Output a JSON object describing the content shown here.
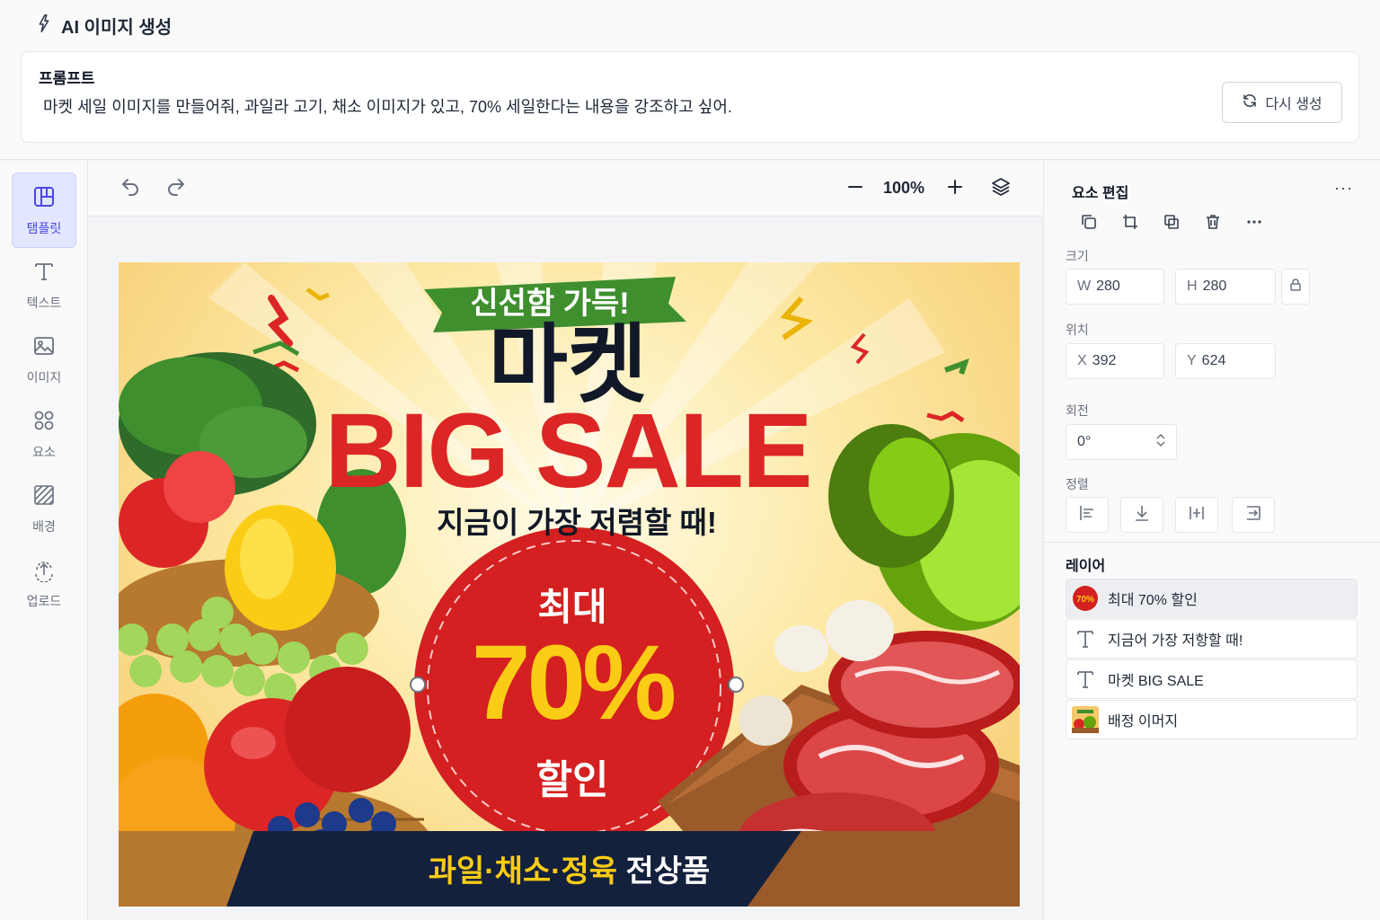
{
  "header": {
    "title": "AI 이미지 생성",
    "prompt_label": "프롬프트",
    "prompt_text": "마켓 세일 이미지를 만들어줘, 과일라 고기, 채소 이미지가 있고, 70% 세일한다는 내용을 강조하고 싶어.",
    "regenerate_label": "다시 생성"
  },
  "sidebar": {
    "items": [
      {
        "label": "탬플릿",
        "icon": "template-icon",
        "active": true
      },
      {
        "label": "텍스트",
        "icon": "text-icon"
      },
      {
        "label": "이미지",
        "icon": "image-icon"
      },
      {
        "label": "요소",
        "icon": "elements-icon"
      },
      {
        "label": "배경",
        "icon": "background-icon"
      },
      {
        "label": "업로드",
        "icon": "upload-icon"
      }
    ]
  },
  "toolbar": {
    "zoom": "100%"
  },
  "canvas": {
    "banner_top": "신선함 가득!",
    "title_market": "마켓",
    "title_sale": "BIG SALE",
    "subtitle": "지금이 가장 저렴할 때!",
    "circle_top": "최대",
    "circle_pct": "70%",
    "circle_bottom": "할인",
    "footer_yellow": "과일·채소·정육",
    "footer_white": "전상품"
  },
  "panel": {
    "title": "요소 편집",
    "more": "···",
    "size_label": "크기",
    "w_prefix": "W",
    "w_value": "280",
    "h_prefix": "H",
    "h_value": "280",
    "position_label": "위치",
    "x_prefix": "X",
    "x_value": "392",
    "y_prefix": "Y",
    "y_value": "624",
    "rotation_label": "회전",
    "rotation_value": "0°",
    "align_label": "정렬",
    "layers_title": "레이어",
    "layers": [
      {
        "label": "최대 70% 할인",
        "thumb": "70%",
        "selected": true
      },
      {
        "label": "지금어 가장 저항할 때!"
      },
      {
        "label": "마켓 BIG SALE"
      },
      {
        "label": "배정 이머지"
      }
    ]
  },
  "colors": {
    "accent": "#4f46e5",
    "sale_red": "#dc2626",
    "sale_yellow": "#facc15",
    "banner_green": "#3f8f2f",
    "footer_navy": "#14213d"
  }
}
